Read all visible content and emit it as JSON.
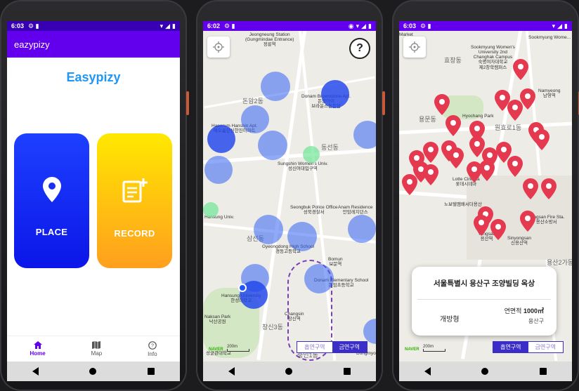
{
  "screen1": {
    "status_time": "6:03",
    "appbar_title": "eazypizy",
    "title": "Easypizy",
    "cards": [
      {
        "label": "PLACE",
        "icon": "location-pin-icon"
      },
      {
        "label": "RECORD",
        "icon": "note-add-icon"
      }
    ],
    "bottom_nav": [
      {
        "label": "Home",
        "icon": "home-icon"
      },
      {
        "label": "Map",
        "icon": "map-icon"
      },
      {
        "label": "Info",
        "icon": "help-circle-icon"
      }
    ]
  },
  "screen2": {
    "status_time": "6:02",
    "help_label": "?",
    "labels": {
      "station1": "Jeongneung Station\n(Gungmindae Entrance)",
      "station1_ko": "정릉역",
      "donam2": "돈암2동",
      "brownstone": "Donam Brownstone Apt.\n돈암아이\n브라운스톤돈암",
      "haeorum": "Haeorum Hanshin Apt.\n해오름한신한진아파트",
      "dongseondong": "동선동",
      "sungshin": "Sungshin Women's Univ.\n성신여대입구역",
      "seongbuk": "Seongbuk Police Office\n성북경찰서",
      "anam": "Anam Residence\n안암레지던스",
      "hansung": "Hansung Univ.",
      "samseondong": "삼선동",
      "gyeongdong": "Gyeongdong High School\n경동고등학교",
      "bomun": "Bomun\n보문역",
      "donam_elem": "Donam Elementary School\n돈암초등학교",
      "hansung_univ": "Hansung University\n한성대학교",
      "naksan": "Naksan Park\n낙산공원",
      "changsin3": "창신3동",
      "changsin": "Changsin\n창신역",
      "sungin1": "숭인1동",
      "dongmyo": "Dongmyo",
      "seonggyun": "성균관대학교"
    },
    "zone_toggle": [
      "흡연구역",
      "금연구역"
    ],
    "active_zone": "금연구역",
    "naver": "NAVER",
    "scale": "200m"
  },
  "screen3": {
    "status_time": "6:03",
    "labels": {
      "sookmyung_univ2": "Sookmyung Women's\nUniversity 2nd\nChanghak Campus\n숙명여자대학교\n제2창학캠퍼스",
      "sookmyung": "Sookmyung Wome...",
      "hyochangdong": "효창동",
      "hyochang_park": "Hyochang Park",
      "yongmundong": "용문동",
      "wonhyo1": "원효로1동",
      "namyeong": "Namyeong\n남영역",
      "lotte": "Lotte Cinema\n롯데시네마",
      "noble": "노보텔앰배서더용산",
      "yongsan": "Yongsan\n용산역",
      "sinyongsan": "Sinyongsan\n신용산역",
      "yongsan_fire": "Yongsan Fire Sta.\n용산소방서",
      "yongsan2ga": "용산2가동",
      "market": "Market"
    },
    "info": {
      "address": "서울특별시 용산구 조양빌딩 옥상",
      "type": "개방형",
      "area_label": "연면적",
      "area_value": "1000㎡",
      "district": "용산구"
    },
    "zone_toggle": [
      "흡연구역",
      "금연구역"
    ],
    "active_zone": "흡연구역",
    "naver": "NAVER",
    "scale": "200m"
  },
  "colors": {
    "primary": "#6200ee",
    "primary_dark": "#3700b3",
    "title_blue": "#2196f3",
    "place_card": "#1e40ff",
    "record_card": "#ffc107",
    "zone_circle": "#3465f5",
    "pin_red": "#e53950",
    "toggle": "#3a2dc8"
  }
}
